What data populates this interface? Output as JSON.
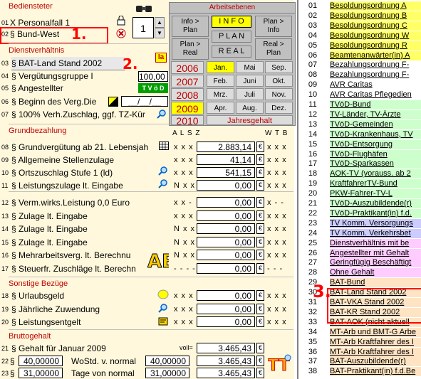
{
  "colors": {
    "section_header": "#c00000",
    "panel_bg": "#c0c0c0",
    "yellow": "#ffff00",
    "tvod_green": "#00a000",
    "annotation_red": "#ff0000"
  },
  "stammdaten": {
    "header": "Bediensteter",
    "rows": [
      {
        "num": "01",
        "flag": "X",
        "label": "Personalfall 1"
      },
      {
        "num": "02",
        "flag": "§",
        "label": "Bund-West"
      }
    ],
    "spinner_value": "1",
    "annotation_1": "1."
  },
  "dienst": {
    "header": "Dienstverhältnis",
    "rows": [
      {
        "num": "03",
        "label": "§ BAT-Land Stand 2002",
        "value": ""
      },
      {
        "num": "04",
        "label": "§ Vergütungsgruppe I",
        "value": "100,00"
      },
      {
        "num": "05",
        "label": "§ Angestellter",
        "value": "T V ö D"
      },
      {
        "num": "06",
        "label": "§ Beginn des Verg.Die",
        "value": "__/__/__"
      },
      {
        "num": "07",
        "label": "§ 100% Verh.Zuschlag, ggf. TZ-Kür",
        "value": ""
      }
    ],
    "annotation_2": "2.",
    "icon_label": "Ia"
  },
  "grund": {
    "header": "Grundbezahlung",
    "col_headers": "A L S Z",
    "col_headers_right": "W T B",
    "rows": [
      {
        "num": "08",
        "label": "§ Grundvergütung ab 21. Lebensjah",
        "xs": "x x x",
        "value": "2.883,14",
        "xs2": "x x x"
      },
      {
        "num": "09",
        "label": "§ Allgemeine Stellenzulage",
        "xs": "x x x",
        "value": "41,14",
        "xs2": "x x x"
      },
      {
        "num": "10",
        "label": "§ Ortszuschlag Stufe 1 (ld)",
        "xs": "x x x",
        "value": "541,15",
        "xs2": "x x x"
      },
      {
        "num": "11",
        "label": "§ Leistungszulage lt. Eingabe",
        "xs": "N x x x",
        "value": "0,00",
        "xs2": "x x x"
      }
    ]
  },
  "zulagen": {
    "rows": [
      {
        "num": "12",
        "label": "§ Verm.wirks.Leistung    0,0 Euro",
        "xs": "x x -",
        "value": "0,00",
        "xs2": "x - -"
      },
      {
        "num": "13",
        "label": "§ Zulage lt. Eingabe",
        "xs": "x x x",
        "value": "0,00",
        "xs2": "x x x"
      },
      {
        "num": "14",
        "label": "§ Zulage lt. Eingabe",
        "xs": "N x x x",
        "value": "0,00",
        "xs2": "x x x"
      },
      {
        "num": "15",
        "label": "§ Zulage lt. Eingabe",
        "xs": "N x x x",
        "value": "0,00",
        "xs2": "x x x"
      },
      {
        "num": "16",
        "label": "§ Mehrarbeitsverg. lt. Berechnu",
        "xs": "N x x x",
        "value": "0,00",
        "xs2": "x x x"
      },
      {
        "num": "17",
        "label": "§ Steuerfr. Zuschläge lt. Berechn",
        "xs": "- - - -",
        "value": "0,00",
        "xs2": "- - -"
      }
    ]
  },
  "bezuege": {
    "header": "Sonstige Bezüge",
    "rows": [
      {
        "num": "18",
        "label": "§ Urlaubsgeld",
        "xs": "x x x",
        "value": "0,00",
        "xs2": "x x x"
      },
      {
        "num": "19",
        "label": "§ Jährliche Zuwendung",
        "xs": "x x x",
        "value": "0,00",
        "xs2": "x x x"
      },
      {
        "num": "20",
        "label": "§ Leistungsentgelt",
        "xs": "x x x",
        "value": "0,00",
        "xs2": "x x x"
      }
    ]
  },
  "brutto": {
    "header": "Bruttogehalt",
    "voll_label": "voll=",
    "rows": [
      {
        "num": "21",
        "label": "§ Gehalt für Januar  2009",
        "in1": "",
        "in2": "",
        "value": "3.465,43"
      },
      {
        "num": "22",
        "label": "WoStd. v. normal",
        "in1": "40,00000",
        "in2": "40,00000",
        "value": "3.465,43"
      },
      {
        "num": "23",
        "label": "Tage von normal",
        "in1": "31,00000",
        "in2": "31,00000",
        "value": "3.465,43"
      }
    ],
    "currency": "€"
  },
  "panel": {
    "title": "Arbeitsebenen",
    "info_to_plan": "Info >\nPlan",
    "info": "I N F O",
    "plan_to_info": "Plan >\nInfo",
    "plan": "P L A N",
    "plan_to_real": "Plan >\nReal",
    "real": "R E A L",
    "real_to_plan": "Real >\nPlan",
    "years": [
      "2006",
      "2007",
      "2008",
      "2009",
      "2010"
    ],
    "months": [
      "Jan.",
      "Mai",
      "Sep.",
      "Feb.",
      "Juni",
      "Okt.",
      "Mrz.",
      "Juli",
      "Nov.",
      "Apr.",
      "Aug.",
      "Dez."
    ],
    "jahresgehalt": "Jahresgehalt"
  },
  "list": {
    "items": [
      {
        "num": "01",
        "text": "Besoldungsordnung A",
        "bg": "#ffff66"
      },
      {
        "num": "02",
        "text": "Besoldungsordnung B",
        "bg": "#ffff66"
      },
      {
        "num": "03",
        "text": "Besoldungsordnung C",
        "bg": "#ffff66"
      },
      {
        "num": "04",
        "text": "Besoldungsordnung W",
        "bg": "#ffff66"
      },
      {
        "num": "05",
        "text": "Besoldungsordnung R",
        "bg": "#ffff66"
      },
      {
        "num": "06",
        "text": "Beamtenanwärter(in) A",
        "bg": "#ffff66"
      },
      {
        "num": "07",
        "text": "Bezahlungsordnung F-",
        "bg": "#ffffff"
      },
      {
        "num": "08",
        "text": "Bezahlungsordnung F-",
        "bg": "#ffffff"
      },
      {
        "num": "09",
        "text": "AVR Caritas",
        "bg": "#ffffff"
      },
      {
        "num": "10",
        "text": "AVR Caritas Pflegedien",
        "bg": "#ffffff"
      },
      {
        "num": "11",
        "text": "TVöD-Bund",
        "bg": "#ccffcc"
      },
      {
        "num": "12",
        "text": "TV-Länder, TV-Ärzte",
        "bg": "#ccffcc"
      },
      {
        "num": "13",
        "text": "TVöD-Gemeinden",
        "bg": "#ccffcc"
      },
      {
        "num": "14",
        "text": "TVöD-Krankenhaus, TV",
        "bg": "#ccffcc"
      },
      {
        "num": "15",
        "text": "TVöD-Entsorgung",
        "bg": "#ccffcc"
      },
      {
        "num": "16",
        "text": "TVöD-Flughäfen",
        "bg": "#ccffcc"
      },
      {
        "num": "17",
        "text": "TVöD-Sparkassen",
        "bg": "#ccffcc"
      },
      {
        "num": "18",
        "text": "AOK-TV  (vorauss. ab 2",
        "bg": "#ccffcc"
      },
      {
        "num": "19",
        "text": "KraftfahrerTV-Bund",
        "bg": "#ccffcc"
      },
      {
        "num": "20",
        "text": "PKW-Fahrer-TV-L",
        "bg": "#ccffcc"
      },
      {
        "num": "21",
        "text": "TVöD-Auszubildende(r)",
        "bg": "#ccffcc"
      },
      {
        "num": "22",
        "text": "TVöD-Praktikant(in) f.d.",
        "bg": "#ccffcc"
      },
      {
        "num": "23",
        "text": "TV Komm. Versorgungs",
        "bg": "#ccccff"
      },
      {
        "num": "24",
        "text": "TV Komm. Verkehrsbet",
        "bg": "#ccccff"
      },
      {
        "num": "25",
        "text": "Dienstverhältnis mit be",
        "bg": "#ffccff"
      },
      {
        "num": "26",
        "text": "Angestellter mit Gehalt",
        "bg": "#ffccff"
      },
      {
        "num": "27",
        "text": "Geringfügig Beschäftigt",
        "bg": "#ffccff"
      },
      {
        "num": "28",
        "text": "Ohne Gehalt",
        "bg": "#ffccff"
      },
      {
        "num": "29",
        "text": "BAT-Bund",
        "bg": "#ffe4c4"
      },
      {
        "num": "30",
        "text": "BAT-Land Stand 2002",
        "bg": "#ffe4c4"
      },
      {
        "num": "31",
        "text": "BAT-VKA Stand 2002",
        "bg": "#ffe4c4"
      },
      {
        "num": "32",
        "text": "BAT-KR Stand 2002",
        "bg": "#ffe4c4"
      },
      {
        "num": "33",
        "text": "BAT-AOK   (nicht aktuell",
        "bg": "#ffe4c4"
      },
      {
        "num": "34",
        "text": "MT-Arb und BMT-G Arbe",
        "bg": "#ffe4c4"
      },
      {
        "num": "35",
        "text": "MT-Arb Kraftfahrer des I",
        "bg": "#ffe4c4"
      },
      {
        "num": "36",
        "text": "MT-Arb Kraftfahrer des I",
        "bg": "#ffe4c4"
      },
      {
        "num": "37",
        "text": "BAT-Auszubildende(r)",
        "bg": "#ffe4c4"
      },
      {
        "num": "38",
        "text": "BAT-Praktikant(in) f.d.Be",
        "bg": "#ffe4c4"
      }
    ],
    "annotation_3": "3."
  }
}
